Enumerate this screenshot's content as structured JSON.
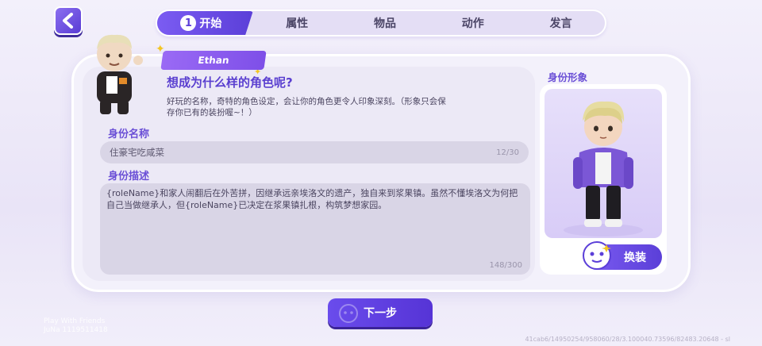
{
  "back": {
    "icon": "chevron-left-icon"
  },
  "tabs": [
    {
      "num": "1",
      "label": "开始",
      "active": true
    },
    {
      "label": "属性"
    },
    {
      "label": "物品"
    },
    {
      "label": "动作"
    },
    {
      "label": "发言"
    }
  ],
  "player": {
    "name": "Ethan"
  },
  "intro": {
    "headline": "想成为什么样的角色呢?",
    "description": "好玩的名称，奇特的角色设定，会让你的角色更令人印象深刻。（形象只会保存你已有的装扮喔~！）"
  },
  "identity_name": {
    "label": "身份名称",
    "value": "住豪宅吃咸菜",
    "counter": "12/30"
  },
  "identity_desc": {
    "label": "身份描述",
    "value": "{roleName}和家人闹翻后在外苦拼，因继承远亲埃洛文的遗产，独自来到浆果镇。虽然不懂埃洛文为何把自己当做继承人，但{roleName}已决定在浆果镇扎根，构筑梦想家园。",
    "counter": "148/300"
  },
  "appearance": {
    "title": "身份形象",
    "change_label": "换装"
  },
  "next_label": "下一步",
  "watermark": {
    "line1": "Play With Friends",
    "line2": "JuNa 1119511418"
  },
  "build_info": "41cab6/14950254/958060/28/3.100040.73596/82483.20648 - sl",
  "colors": {
    "accent": "#5b3fd8",
    "accent_light": "#7b5cf2",
    "label": "#6a4fd6",
    "field_bg": "#d9d5e6"
  }
}
